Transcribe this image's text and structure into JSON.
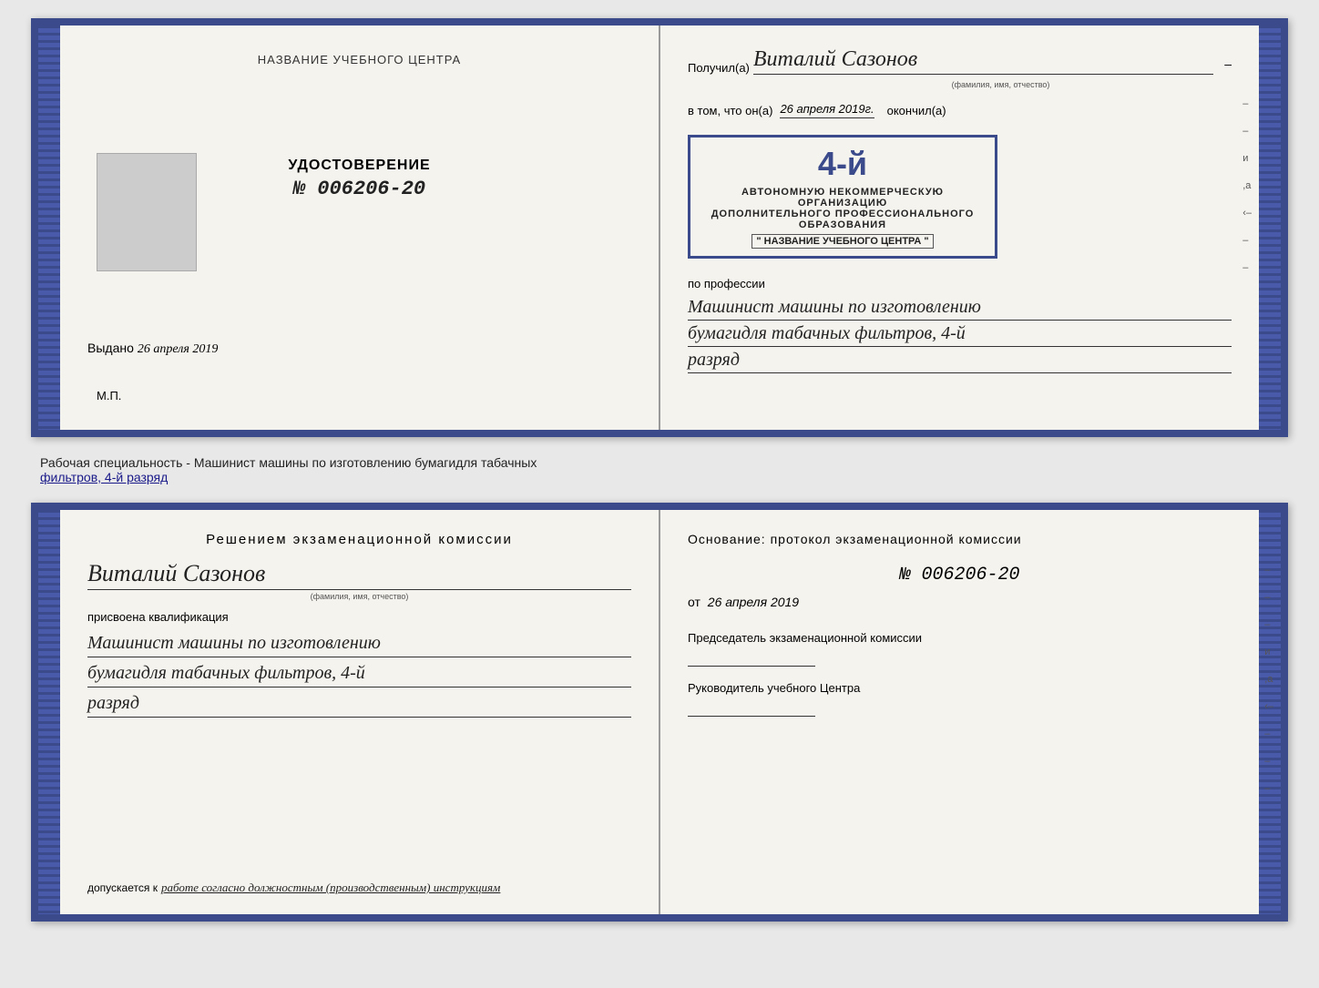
{
  "topDoc": {
    "leftPage": {
      "title": "НАЗВАНИЕ УЧЕБНОГО ЦЕНТРА",
      "certLabel": "УДОСТОВЕРЕНИЕ",
      "certNumber": "№ 006206-20",
      "issuedLabel": "Выдано",
      "issuedDate": "26 апреля 2019",
      "mp": "М.П."
    },
    "rightPage": {
      "receivedLabel": "Получил(а)",
      "recipientName": "Виталий Сазонов",
      "fioHint": "(фамилия, имя, отчество)",
      "vtomLabel": "в том, что он(а)",
      "vtomDate": "26 апреля 2019г.",
      "okonchilLabel": "окончил(а)",
      "stampNumber": "4-й",
      "stampLine1": "АВТОНОМНУЮ НЕКОММЕРЧЕСКУЮ ОРГАНИЗАЦИЮ",
      "stampLine2": "ДОПОЛНИТЕЛЬНОГО ПРОФЕССИОНАЛЬНОГО ОБРАЗОВАНИЯ",
      "stampLine3": "\" НАЗВАНИЕ УЧЕБНОГО ЦЕНТРА \"",
      "professionLabel": "по профессии",
      "professionLine1": "Машинист машины по изготовлению",
      "professionLine2": "бумагидля табачных фильтров, 4-й",
      "professionLine3": "разряд",
      "sideMarks": [
        "–",
        "–",
        "и",
        ",а",
        "‹–",
        "–",
        "–",
        "–"
      ]
    }
  },
  "middleText": {
    "line1": "Рабочая специальность - Машинист машины по изготовлению бумагидля табачных",
    "line2": "фильтров, 4-й разряд"
  },
  "bottomDoc": {
    "leftPage": {
      "title": "Решением  экзаменационной  комиссии",
      "personName": "Виталий Сазонов",
      "fioHint": "(фамилия, имя, отчество)",
      "assignedLabel": "присвоена квалификация",
      "qualLine1": "Машинист машины по изготовлению",
      "qualLine2": "бумагидля табачных фильтров, 4-й",
      "qualLine3": "разряд",
      "dopuskLabel": "допускается к",
      "dopuskValue": "работе согласно должностным (производственным) инструкциям"
    },
    "rightPage": {
      "osnovLabel": "Основание: протокол экзаменационной  комиссии",
      "number": "№  006206-20",
      "datePrefix": "от",
      "date": "26 апреля 2019",
      "predsedLabel": "Председатель экзаменационной комиссии",
      "rukLabel": "Руководитель учебного Центра",
      "sideMarks": [
        "–",
        "–",
        "–",
        "и",
        ",а",
        "‹–",
        "–",
        "–",
        "–"
      ]
    }
  }
}
